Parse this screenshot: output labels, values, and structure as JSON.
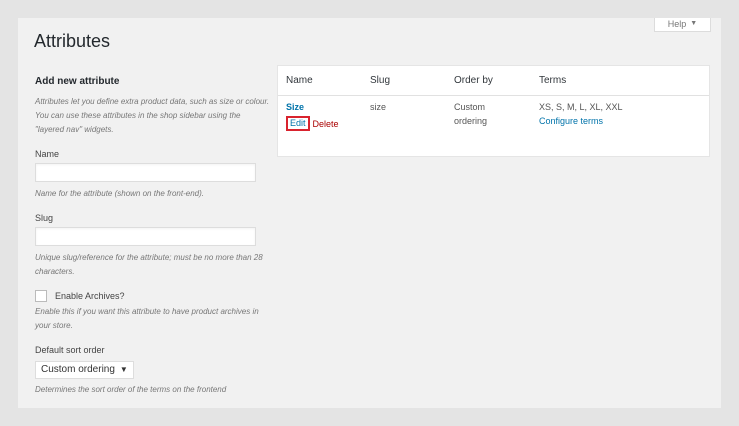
{
  "help": {
    "label": "Help",
    "icon": "caret-down-icon"
  },
  "page": {
    "title": "Attributes"
  },
  "form": {
    "heading": "Add new attribute",
    "description": "Attributes let you define extra product data, such as size or colour. You can use these attributes in the shop sidebar using the \"layered nav\" widgets.",
    "name_label": "Name",
    "name_value": "",
    "name_help": "Name for the attribute (shown on the front-end).",
    "slug_label": "Slug",
    "slug_value": "",
    "slug_help": "Unique slug/reference for the attribute; must be no more than 28 characters.",
    "archives_label": "Enable Archives?",
    "archives_help": "Enable this if you want this attribute to have product archives in your store.",
    "sort_label": "Default sort order",
    "sort_value": "Custom ordering",
    "sort_help": "Determines the sort order of the terms on the frontend"
  },
  "table": {
    "columns": [
      "Name",
      "Slug",
      "Order by",
      "Terms"
    ],
    "rows": [
      {
        "name": "Size",
        "edit": "Edit",
        "delete": "Delete",
        "slug": "size",
        "order_line1": "Custom",
        "order_line2": "ordering",
        "terms": "XS, S, M, L, XL, XXL",
        "configure": "Configure terms"
      }
    ]
  },
  "colors": {
    "link": "#0073aa",
    "delete": "#aa0000",
    "highlight": "#d9232e"
  }
}
